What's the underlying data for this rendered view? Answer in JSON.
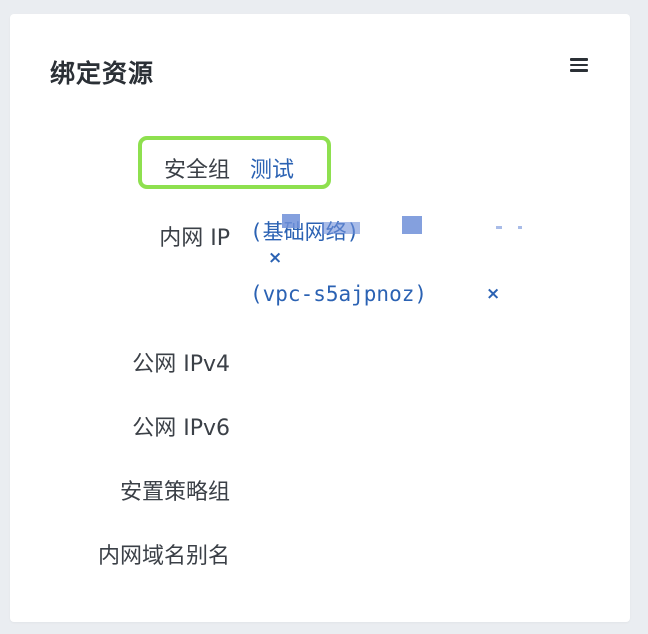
{
  "card": {
    "title": "绑定资源",
    "menu_icon": "hamburger-menu-icon"
  },
  "fields": {
    "security_group": {
      "label": "安全组",
      "value": "测试"
    },
    "private_ip": {
      "label": "内网 IP",
      "first_entry_prefix": "(基础网络)",
      "remove_symbol": "×",
      "second_entry": "(vpc-s5ajpnoz)"
    },
    "public_ipv4": {
      "label": "公网 IPv4"
    },
    "public_ipv6": {
      "label": "公网 IPv6"
    },
    "placement_group": {
      "label": "安置策略组"
    },
    "private_dns_alias": {
      "label": "内网域名别名"
    }
  },
  "colors": {
    "link": "#2b62b3",
    "highlight_border": "#8ee04f",
    "text": "#3b4047",
    "background": "#eaedf1"
  }
}
